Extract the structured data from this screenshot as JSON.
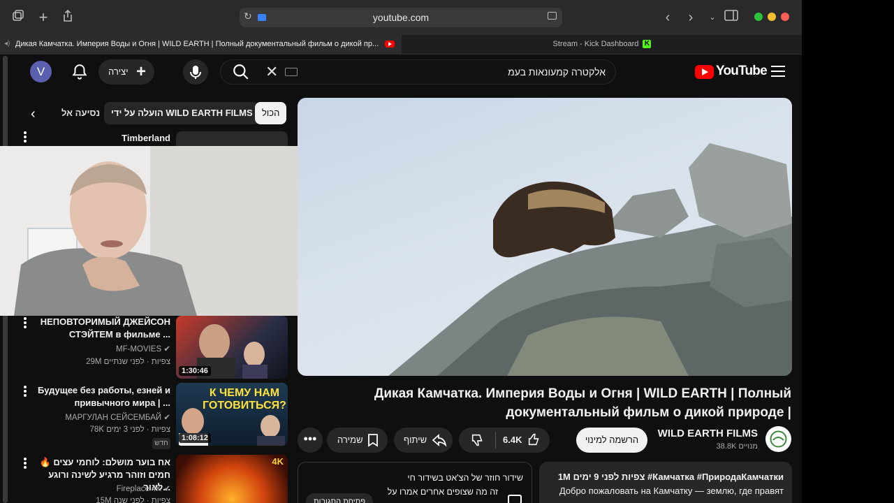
{
  "browser": {
    "url": "youtube.com",
    "tabs": [
      {
        "label": "Дикая Камчатка. Империя Воды и Огня | WILD EARTH | Полный документальный фильм о дикой пр..."
      },
      {
        "label": "Stream - Kick Dashboard"
      }
    ]
  },
  "header": {
    "avatar_letter": "V",
    "create_label": "יצירה",
    "search_query": "אלקטרה קמעונאות בעמ",
    "logo_text": "YouTube"
  },
  "chips": {
    "all": "הכול",
    "uploaded_by": "הועלה על ידי WILD EARTH FILMS",
    "travel": "נסיעה אל"
  },
  "recommendations": [
    {
      "title": "Timberland",
      "channel": "",
      "meta": "",
      "duration": ""
    },
    {
      "title": "НЕПОВТОРИМЫЙ ДЖЕЙСОН СТЭЙТЕМ в фильме ...",
      "channel": "MF-MOVIES",
      "meta": "29M צפיות · לפני שנתיים",
      "duration": "1:30:46"
    },
    {
      "title": "Будущее без работы, езней и привычного мира | ...",
      "channel": "МАРГУЛАН СЕЙСЕМБАЙ",
      "meta": "78K צפיות · לפני 3 ימים",
      "badge": "חדש",
      "duration": "1:08:12",
      "thumb_text": "К ЧЕМУ НАМ ГОТОВИТЬСЯ?"
    },
    {
      "title": "🔥 אח בוער מושלם: לוחמי עצים חמים וזוהר מרגיע לשינה ורוגע לאור...",
      "channel": "Fireplace 4K",
      "meta": "15M צפיות · לפני שנה",
      "duration": "",
      "thumb_text": "4K"
    }
  ],
  "video": {
    "title": "Дикая Камчатка. Империя Воды и Огня | WILD EARTH | Полный документальный фильм о дикой природе |",
    "channel": "WILD EARTH FILMS",
    "subscribers": "38.8K מנויים",
    "subscribe_label": "הרשמה למינוי",
    "likes": "6.4K",
    "share_label": "שיתוף",
    "save_label": "שמירה"
  },
  "description": {
    "stats": "1M צפיות  לפני 9 ימים  #Камчатка #ПриродаКамчатки",
    "text": "Добро пожаловать на Камчатку — землю, где правят"
  },
  "chat": {
    "line1": "שידור חוזר של הצ'אט בשידור חי",
    "line2": "זה מה שצופים אחרים אמרו על",
    "button": "פתיחת התגובות"
  }
}
